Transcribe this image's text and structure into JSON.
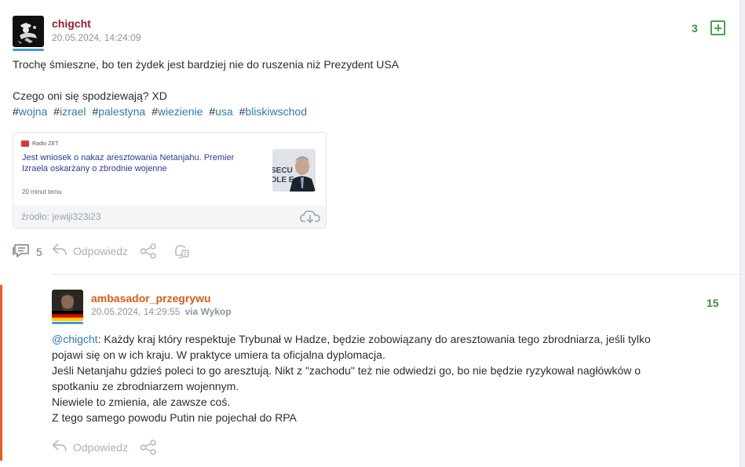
{
  "post": {
    "author": "chigcht",
    "timestamp": "20.05.2024, 14:24:09",
    "votes": "3",
    "paragraph1": "Trochę śmieszne, bo ten żydek jest bardziej nie do ruszenia niż Prezydent USA",
    "paragraph2": "Czego oni się spodziewają? XD",
    "tags": [
      "wojna",
      "izrael",
      "palestyna",
      "wiezienie",
      "usa",
      "bliskiwschod"
    ],
    "embed": {
      "brand": "Radio ZET",
      "title": "Jest wniosek o nakaz aresztowania Netanjahu. Premier Izraela oskarżany o zbrodnie wojenne",
      "time": "20 minut temu",
      "source": "źródło: jewiji323i23"
    },
    "actions": {
      "comment_count": "5",
      "reply_label": "Odpowiedz"
    }
  },
  "comment": {
    "author": "ambasador_przegrywu",
    "timestamp": "20.05.2024, 14:29:55",
    "via": "via Wykop",
    "votes": "15",
    "mention": "@chigcht",
    "line1": ": Każdy kraj który respektuje Trybunał w Hadze, będzie zobowiązany do aresztowania tego zbrodniarza, jeśli tylko",
    "line2": "pojawi się on w ich kraju. W praktyce umiera ta oficjalna dyplomacja.",
    "line3": "Jeśli Netanjahu gdzieś poleci to go aresztują. Nikt z \"zachodu\" też nie odwiedzi go, bo nie będzie ryzykował nagłówków o",
    "line4": "spotkaniu ze zbrodniarzem wojennym.",
    "line5": "Niewiele to zmienia, ale zawsze coś.",
    "line6": "Z tego samego powodu Putin nie pojechał do RPA",
    "reply_label": "Odpowiedz"
  },
  "colors": {
    "author_post": "#9e1b2a",
    "author_comment": "#e05a13",
    "link": "#2f79b4",
    "vote_green": "#3b8e3b",
    "reply_bar": "#f05a1f"
  }
}
